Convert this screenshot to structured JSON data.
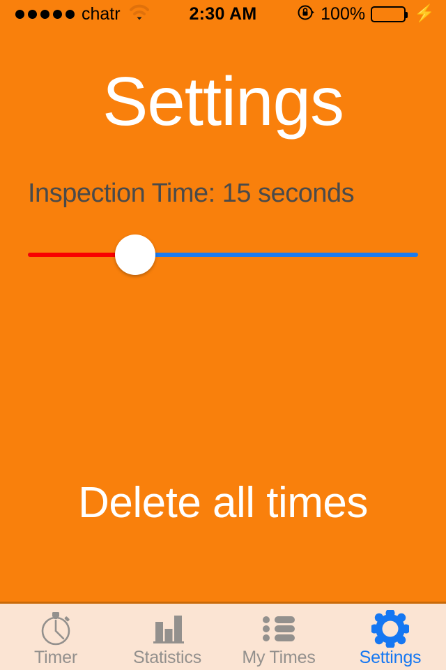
{
  "status_bar": {
    "signal_dots": 5,
    "carrier": "chatr",
    "wifi_icon": "wifi-icon",
    "time": "2:30 AM",
    "rotation_lock_icon": "rotation-lock-icon",
    "battery_percent": "100%",
    "battery_color": "#4CE15E",
    "charging_icon": "lightning-bolt-icon"
  },
  "screen": {
    "title": "Settings",
    "background_color": "#F9800C",
    "title_color": "#FFFFFF"
  },
  "inspection": {
    "label": "Inspection Time: 15 seconds",
    "value": 15,
    "unit": "seconds",
    "slider": {
      "min": 0,
      "max": 60,
      "value": 15,
      "percent": 27,
      "left_track_color": "#F90000",
      "right_track_color": "#1C7BEE",
      "thumb_color": "#FFFFFF"
    }
  },
  "actions": {
    "delete_all_times": "Delete all times"
  },
  "tab_bar": {
    "background_color": "#FBE4D3",
    "inactive_color": "#93908D",
    "active_color": "#1577F2",
    "items": [
      {
        "label": "Timer",
        "icon": "stopwatch-icon",
        "active": false
      },
      {
        "label": "Statistics",
        "icon": "bar-chart-icon",
        "active": false
      },
      {
        "label": "My Times",
        "icon": "bulleted-list-icon",
        "active": false
      },
      {
        "label": "Settings",
        "icon": "gear-icon",
        "active": true
      }
    ]
  }
}
